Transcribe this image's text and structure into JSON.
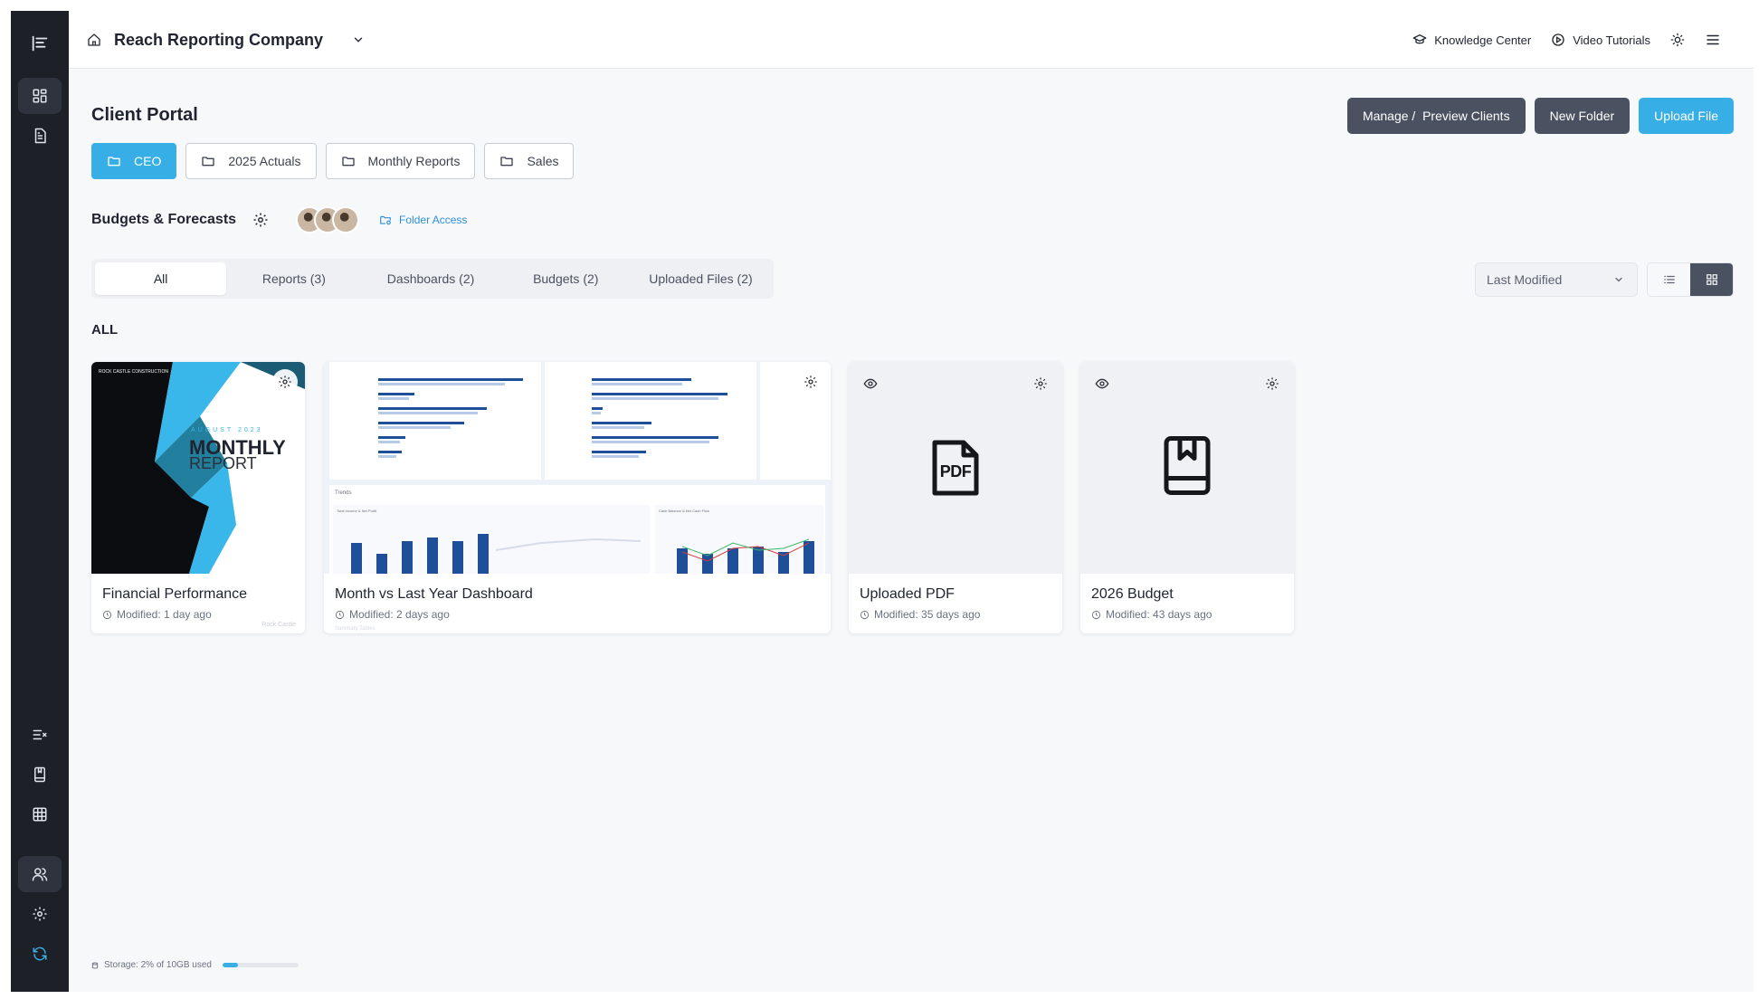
{
  "header": {
    "company": "Reach Reporting Company",
    "links": [
      {
        "label": "Knowledge Center",
        "icon": "graduation-cap-icon"
      },
      {
        "label": "Video Tutorials",
        "icon": "play-circle-icon"
      }
    ]
  },
  "page": {
    "title": "Client Portal",
    "actions": {
      "manage": "Manage /  Preview Clients",
      "new_folder": "New Folder",
      "upload": "Upload File"
    }
  },
  "folders": [
    "CEO",
    "2025 Actuals",
    "Monthly Reports",
    "Sales"
  ],
  "subfolder": {
    "title": "Budgets & Forecasts",
    "folder_access": "Folder Access"
  },
  "tabs": [
    "All",
    "Reports (3)",
    "Dashboards (2)",
    "Budgets (2)",
    "Uploaded Files (2)"
  ],
  "sort": {
    "selected": "Last Modified"
  },
  "section_label": "ALL",
  "cards": [
    {
      "title": "Financial Performance",
      "modified": "Modified: 1 day ago",
      "thumb": {
        "year": "AUGUST 2023",
        "line1": "MONTHLY",
        "line2": "REPORT",
        "brand": "ROCK CASTLE CONSTRUCTION",
        "brand_footer": "Rock Castle"
      }
    },
    {
      "title": "Month vs Last Year Dashboard",
      "modified": "Modified: 2 days ago",
      "thumb": {
        "section": "Trends",
        "chart1": "Total Income & Net Profit",
        "chart2": "Cash Balance & Net Cash Flow",
        "footer": "Summary Tables"
      }
    },
    {
      "title": "Uploaded PDF",
      "modified": "Modified: 35 days ago",
      "thumb": {
        "badge": "PDF"
      }
    },
    {
      "title": "2026 Budget",
      "modified": "Modified: 43 days ago"
    }
  ],
  "storage": {
    "text": "Storage: 2% of 10GB used",
    "used_percent": 2
  },
  "colors": {
    "accent": "#38aee6",
    "dark_button": "#4a5160",
    "rail": "#1d2027"
  }
}
